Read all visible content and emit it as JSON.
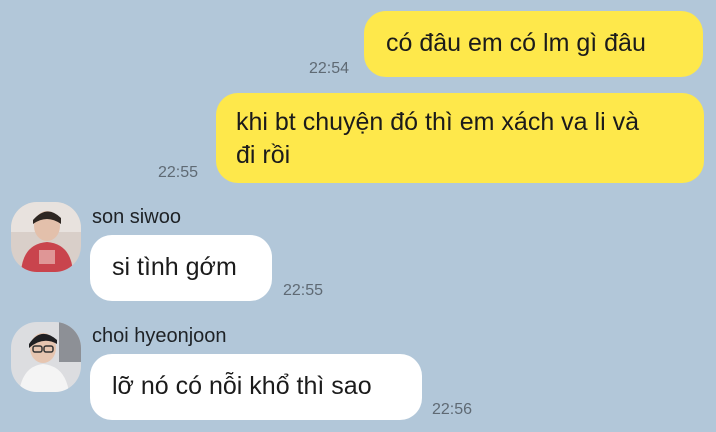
{
  "messages": [
    {
      "direction": "outgoing",
      "text": "có đâu em có lm gì đâu",
      "time": "22:54"
    },
    {
      "direction": "outgoing",
      "text_lines": [
        "khi bt chuyện đó thì em xách va li và",
        "đi rồi"
      ],
      "time": "22:55"
    },
    {
      "direction": "incoming",
      "sender": "son siwoo",
      "avatar": "profile-photo",
      "text": "si tình gớm",
      "time": "22:55"
    },
    {
      "direction": "incoming",
      "sender": "choi hyeonjoon",
      "avatar": "profile-photo",
      "text": "lỡ nó có nỗi khổ thì sao",
      "time": "22:56"
    }
  ],
  "colors": {
    "background": "#b2c7d9",
    "outgoing_bubble": "#fee84b",
    "incoming_bubble": "#ffffff",
    "timestamp": "#5f6a74"
  }
}
